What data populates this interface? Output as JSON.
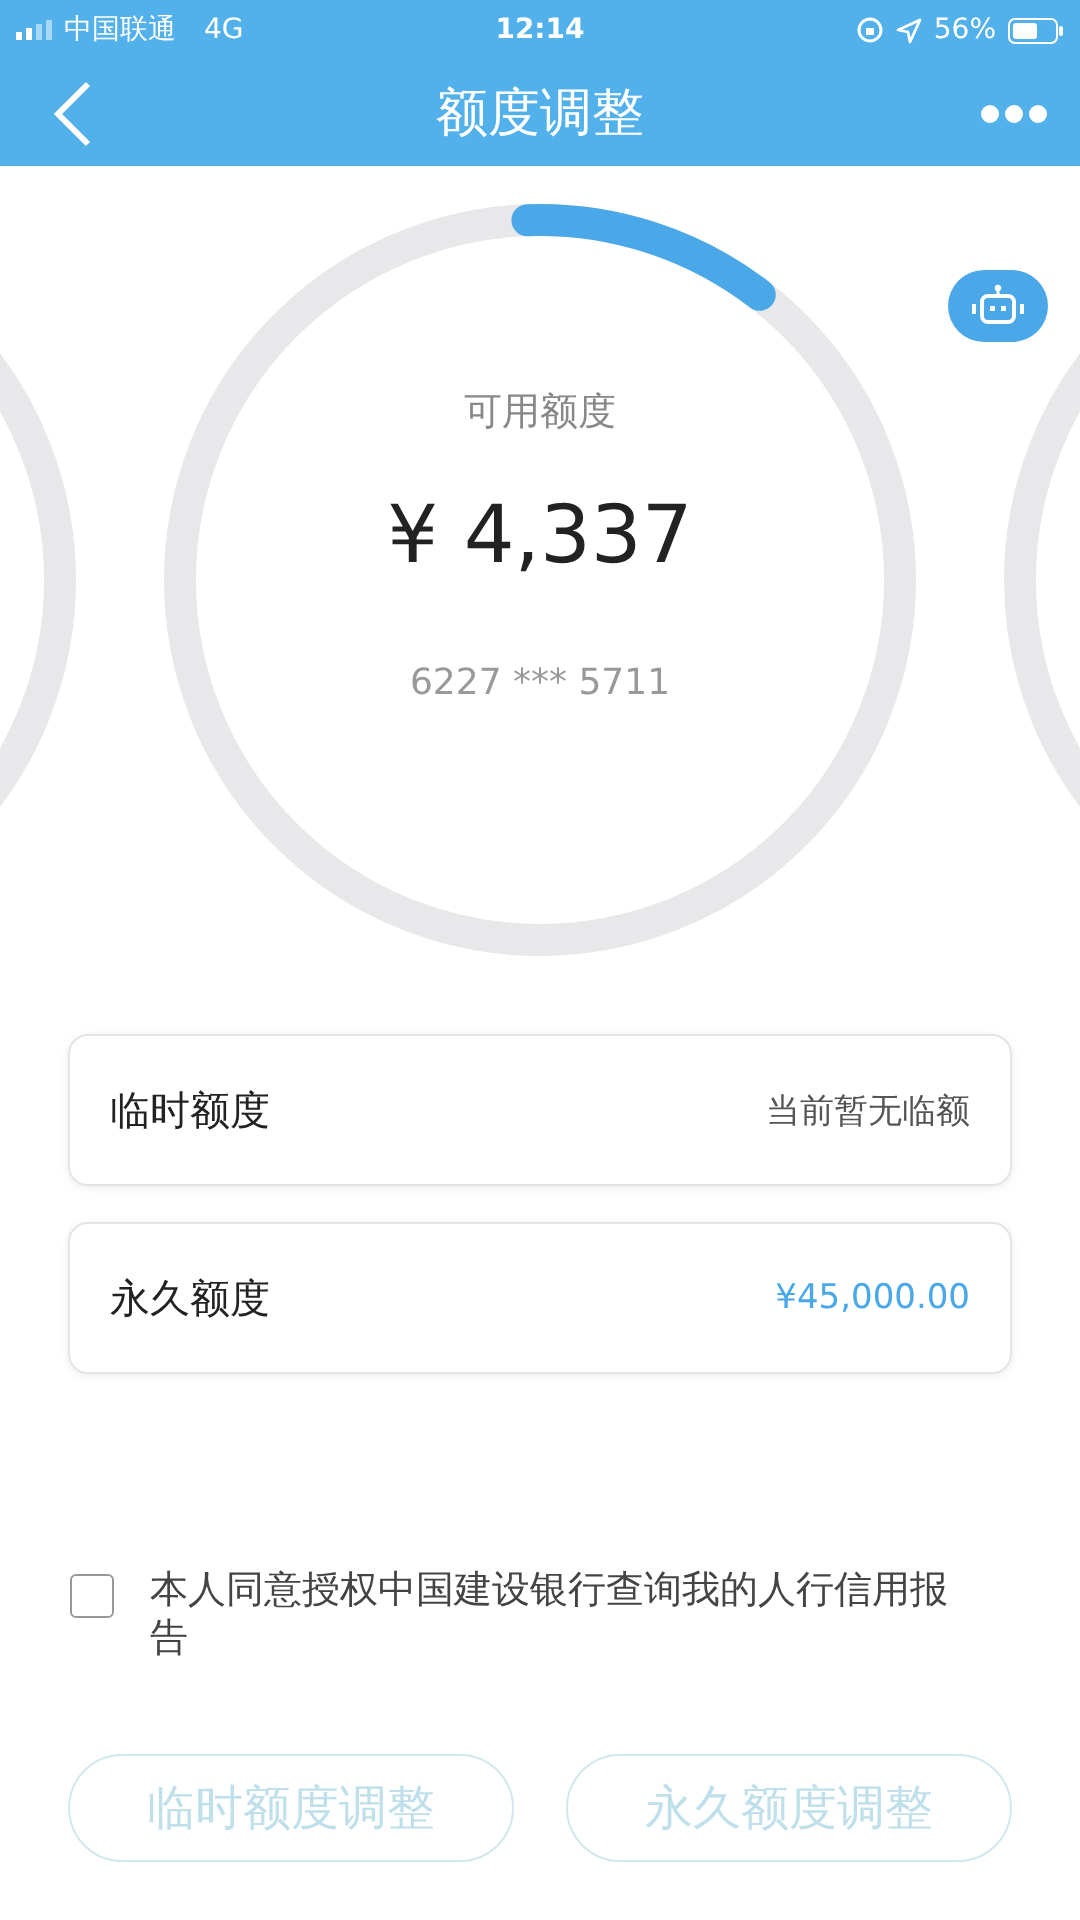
{
  "status_bar": {
    "carrier": "中国联通",
    "network": "4G",
    "time": "12:14",
    "battery": "56%"
  },
  "nav": {
    "title": "额度调整"
  },
  "ring": {
    "label": "可用额度",
    "amount": "¥ 4,337",
    "card_number": "6227 *** 5711"
  },
  "rows": [
    {
      "label": "临时额度",
      "value": "当前暂无临额",
      "kind": "plain"
    },
    {
      "label": "永久额度",
      "value": "¥45,000.00",
      "kind": "accent"
    }
  ],
  "consent": {
    "text": "本人同意授权中国建设银行查询我的人行信用报告",
    "checked": false
  },
  "buttons": [
    {
      "label": "临时额度调整",
      "disabled": true
    },
    {
      "label": "永久额度调整",
      "disabled": true
    }
  ]
}
